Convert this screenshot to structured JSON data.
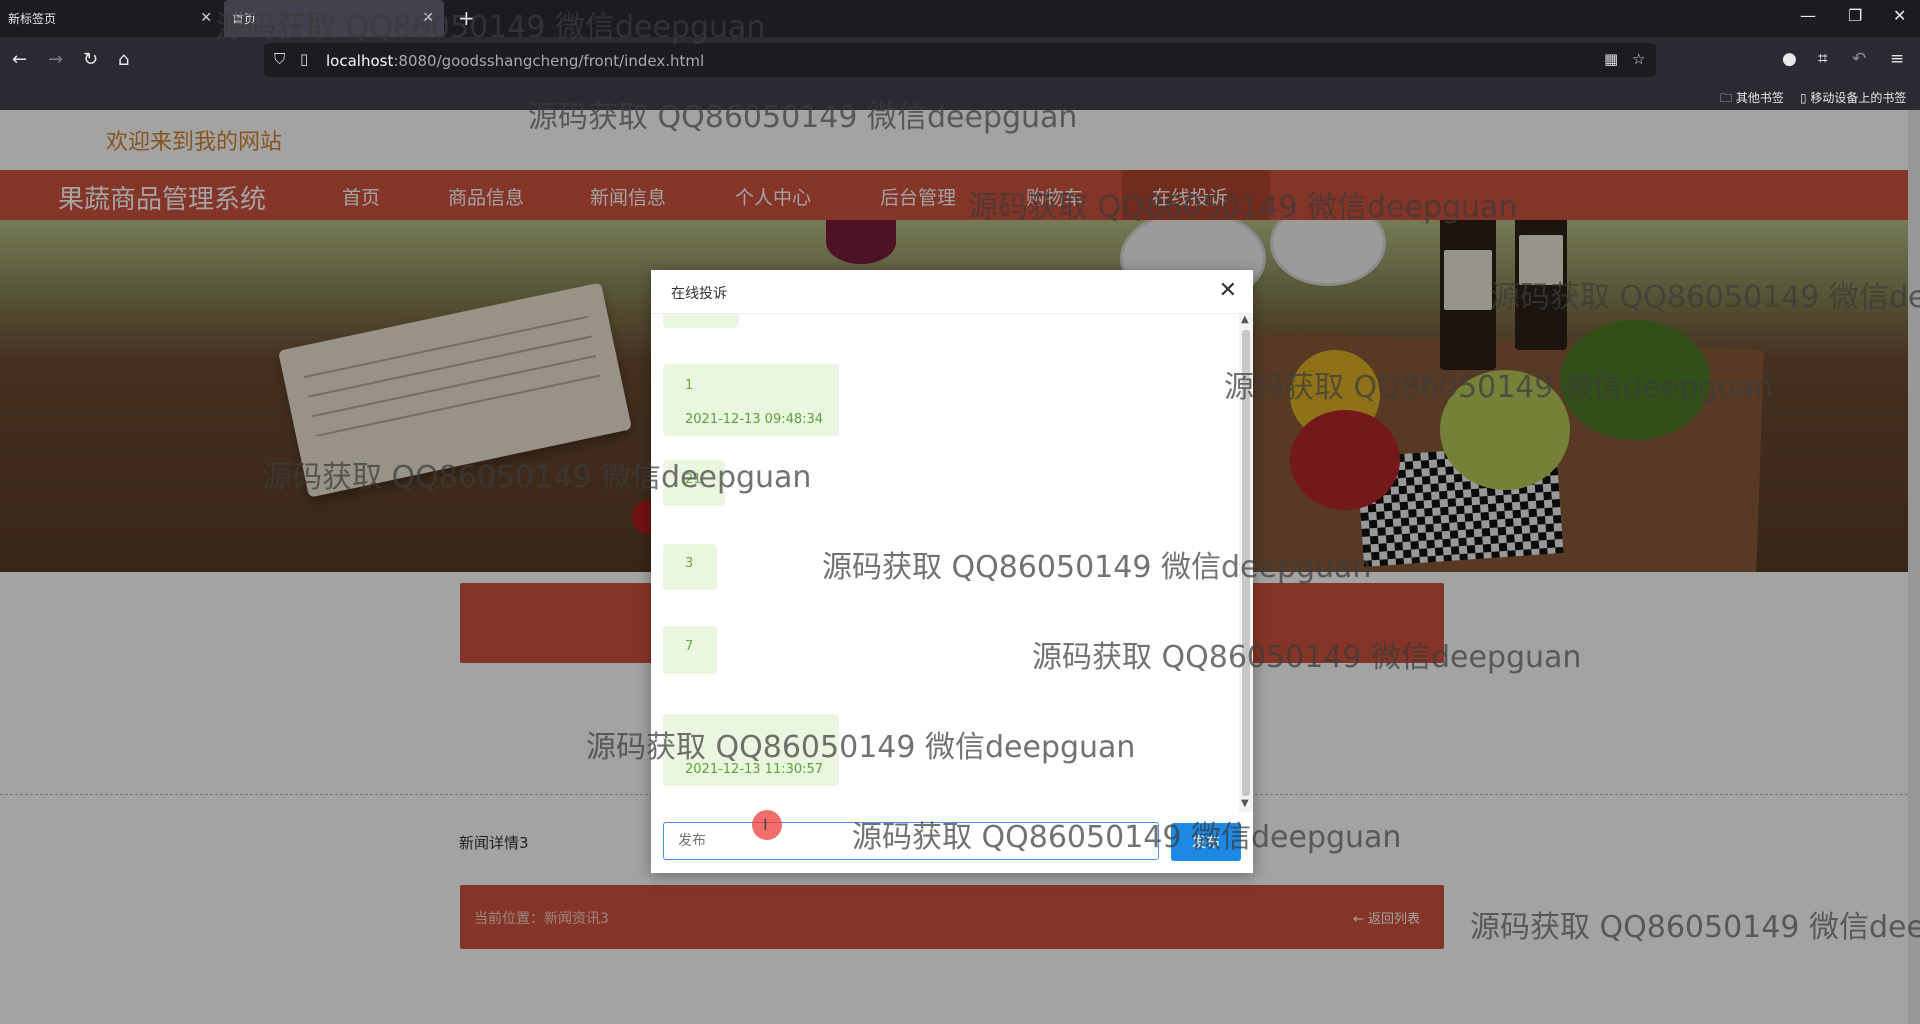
{
  "browser": {
    "tabs": [
      {
        "label": "新标签页"
      },
      {
        "label": "首页"
      }
    ],
    "url_host": "localhost",
    "url_rest": ":8080/goodsshangcheng/front/index.html",
    "bookmarks": {
      "other": "其他书签",
      "mobile": "移动设备上的书签"
    }
  },
  "site": {
    "welcome": "欢迎来到我的网站",
    "brand": "果蔬商品管理系统",
    "nav": [
      {
        "label": "首页"
      },
      {
        "label": "商品信息"
      },
      {
        "label": "新闻信息"
      },
      {
        "label": "个人中心"
      },
      {
        "label": "后台管理"
      },
      {
        "label": "购物车"
      },
      {
        "label": "在线投诉"
      }
    ],
    "news_title": "新闻详情3",
    "current_position": "当前位置：新闻资讯3",
    "back_to_list": "返回列表"
  },
  "modal": {
    "title": "在线投诉",
    "messages": [
      {
        "text": "1",
        "time": "2021-12-13 09:48:34"
      },
      {
        "text": "21"
      },
      {
        "text": "3"
      },
      {
        "text": "7"
      },
      {
        "text": "",
        "time": "2021-12-13 11:30:57"
      }
    ],
    "input_placeholder": "发布",
    "send_label": "发布"
  },
  "watermark": "源码获取 QQ86050149 微信deepguan"
}
